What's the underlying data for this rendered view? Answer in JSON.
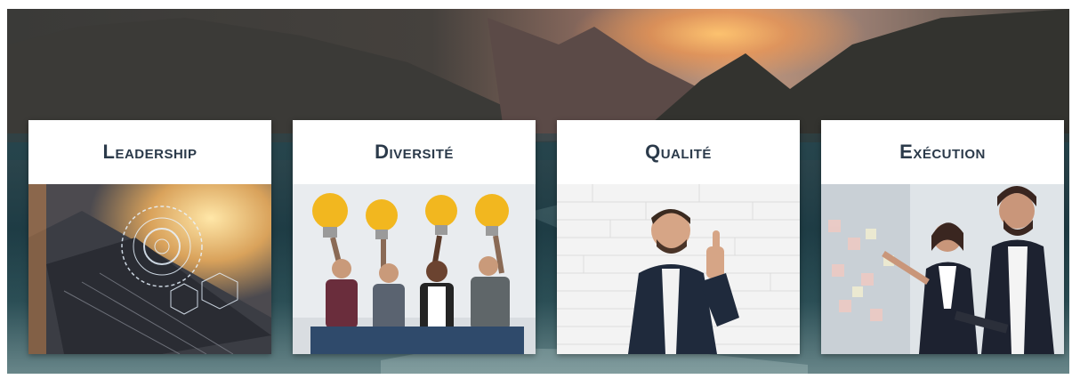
{
  "banner": {
    "cards": [
      {
        "title": "Leadership",
        "image": "laptop-hud-photo"
      },
      {
        "title": "Diversité",
        "image": "people-holding-lightbulbs-photo"
      },
      {
        "title": "Qualité",
        "image": "man-thumbs-up-photo"
      },
      {
        "title": "Exécution",
        "image": "business-meeting-photo"
      }
    ]
  }
}
